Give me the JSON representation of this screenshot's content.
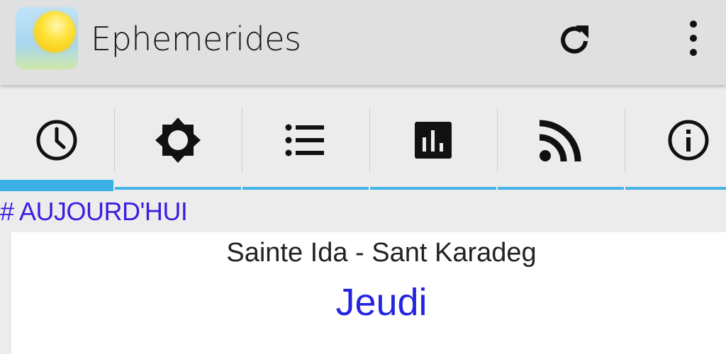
{
  "appbar": {
    "title": "Ephemerides",
    "icons": {
      "app": "sun-app-icon",
      "refresh": "refresh-icon",
      "more": "more-vert-icon"
    }
  },
  "tabs": [
    {
      "icon": "clock-icon",
      "active": true
    },
    {
      "icon": "brightness-icon",
      "active": false
    },
    {
      "icon": "list-icon",
      "active": false
    },
    {
      "icon": "bar-chart-icon",
      "active": false
    },
    {
      "icon": "rss-feed-icon",
      "active": false
    },
    {
      "icon": "info-icon",
      "active": false
    }
  ],
  "colors": {
    "accent": "#3ab0e5",
    "heading": "#3a1ee0",
    "day": "#2525e0"
  },
  "today": {
    "heading": "# AUJOURD'HUI",
    "saint": "Sainte Ida - Sant Karadeg",
    "day": "Jeudi"
  }
}
